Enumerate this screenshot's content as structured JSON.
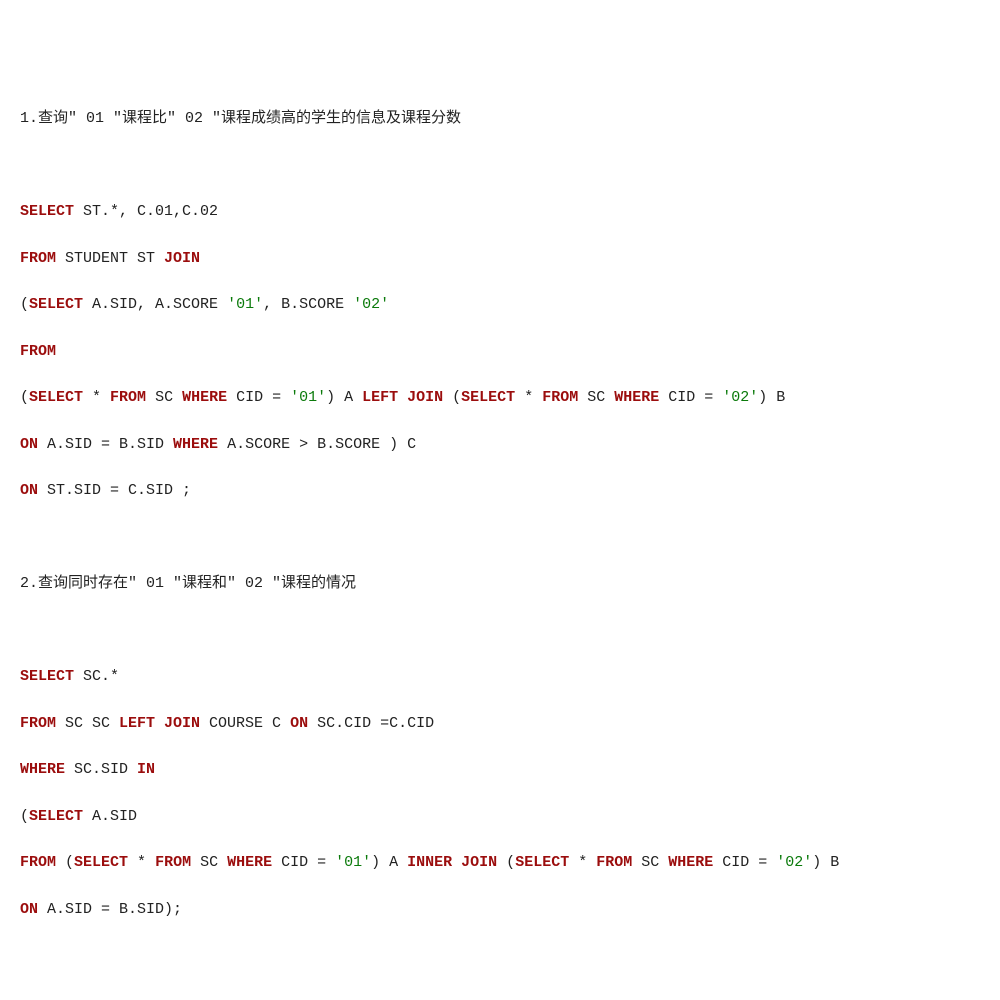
{
  "q1": {
    "title": "1.查询\" 01 \"课程比\" 02 \"课程成绩高的学生的信息及课程分数",
    "l1": {
      "a": "SELECT",
      "b": " ST.*, C.01,C.02"
    },
    "l2": {
      "a": "FROM",
      "b": " STUDENT ST ",
      "c": "JOIN"
    },
    "l3": {
      "a": "(",
      "b": "SELECT",
      "c": " A.SID, A.SCORE ",
      "d": "'01'",
      "e": ", B.SCORE ",
      "f": "'02'"
    },
    "l4": {
      "a": "FROM"
    },
    "l5": {
      "a": "(",
      "b": "SELECT",
      "c": " * ",
      "d": "FROM",
      "e": " SC ",
      "f": "WHERE",
      "g": " CID = ",
      "h": "'01'",
      "i": ") A ",
      "j": "LEFT JOIN",
      "k": " (",
      "l": "SELECT",
      "m": " * ",
      "n": "FROM",
      "o": " SC ",
      "p": "WHERE",
      "q": " CID = ",
      "r": "'02'",
      "s": ") B"
    },
    "l6": {
      "a": "ON",
      "b": " A.SID = B.SID ",
      "c": "WHERE",
      "d": " A.SCORE > B.SCORE ) C"
    },
    "l7": {
      "a": "ON",
      "b": " ST.SID = C.SID ;"
    }
  },
  "q2": {
    "title": "2.查询同时存在\" 01 \"课程和\" 02 \"课程的情况",
    "l1": {
      "a": "SELECT",
      "b": " SC.*"
    },
    "l2": {
      "a": "FROM",
      "b": " SC SC ",
      "c": "LEFT JOIN",
      "d": " COURSE C ",
      "e": "ON",
      "f": " SC.CID =C.CID"
    },
    "l3": {
      "a": "WHERE",
      "b": " SC.SID ",
      "c": "IN"
    },
    "l4": {
      "a": "(",
      "b": "SELECT",
      "c": " A.SID"
    },
    "l5": {
      "a": "FROM",
      "b": " (",
      "c": "SELECT",
      "d": " * ",
      "e": "FROM",
      "f": " SC ",
      "g": "WHERE",
      "h": " CID = ",
      "i": "'01'",
      "j": ") A ",
      "k": "INNER JOIN",
      "l": " (",
      "m": "SELECT",
      "n": " * ",
      "o": "FROM",
      "p": " SC ",
      "q": "WHERE",
      "r": " CID = ",
      "s": "'02'",
      "t": ") B"
    },
    "l6": {
      "a": "ON",
      "b": " A.SID = B.SID);"
    }
  }
}
